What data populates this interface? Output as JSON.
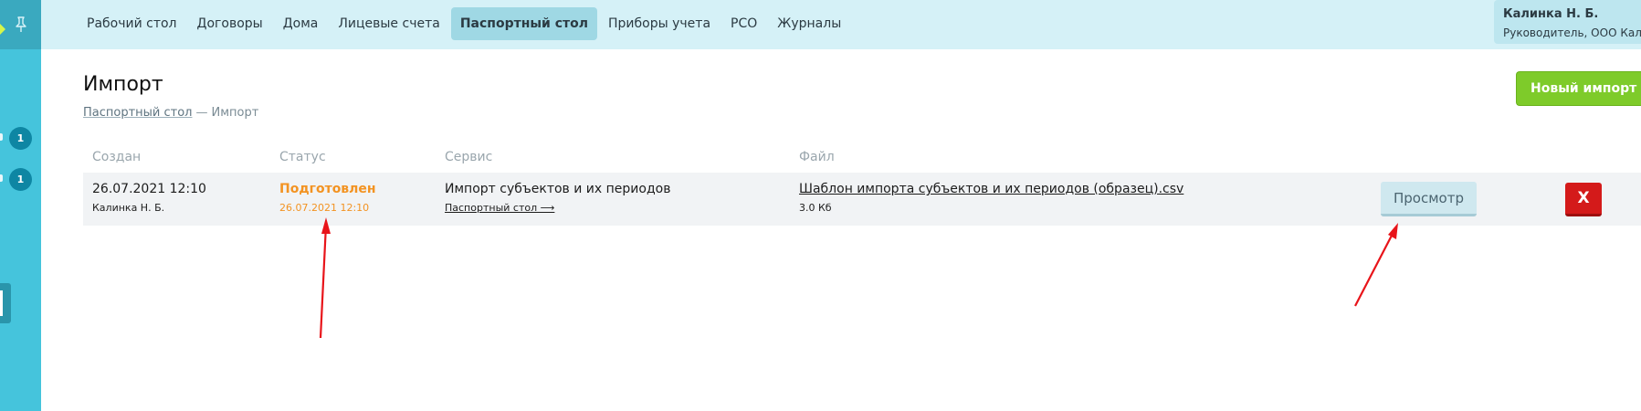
{
  "nav": {
    "items": [
      {
        "label": "Рабочий стол",
        "active": false
      },
      {
        "label": "Договоры",
        "active": false
      },
      {
        "label": "Дома",
        "active": false
      },
      {
        "label": "Лицевые счета",
        "active": false
      },
      {
        "label": "Паспортный стол",
        "active": true
      },
      {
        "label": "Приборы учета",
        "active": false
      },
      {
        "label": "РСО",
        "active": false
      },
      {
        "label": "Журналы",
        "active": false
      }
    ]
  },
  "user": {
    "name": "Калинка Н. Б.",
    "role": "Руководитель, ООО Калин"
  },
  "sidebar": {
    "badges": [
      "1",
      "1"
    ],
    "icons": [
      "pin-icon"
    ]
  },
  "page": {
    "title": "Импорт",
    "breadcrumb_parent": "Паспортный стол",
    "breadcrumb_sep": "—",
    "breadcrumb_current": "Импорт",
    "new_import_label": "Новый импорт"
  },
  "table": {
    "headers": {
      "created": "Создан",
      "status": "Статус",
      "service": "Сервис",
      "file": "Файл"
    },
    "rows": [
      {
        "created_date": "26.07.2021 12:10",
        "created_by": "Калинка Н. Б.",
        "status": "Подготовлен",
        "status_date": "26.07.2021 12:10",
        "service": "Импорт субъектов и их периодов",
        "service_link": "Паспортный стол ⟶",
        "file_name": "Шаблон импорта субъектов и их периодов (образец).csv",
        "file_size": "3.0 Кб",
        "view_label": "Просмотр",
        "delete_label": "X"
      }
    ]
  },
  "colors": {
    "sidebar": "#45c4dc",
    "topbar": "#d5f1f7",
    "status": "#f39322",
    "new_import": "#7ecb2a",
    "delete": "#d41a1a",
    "annotation": "#e8141a"
  }
}
